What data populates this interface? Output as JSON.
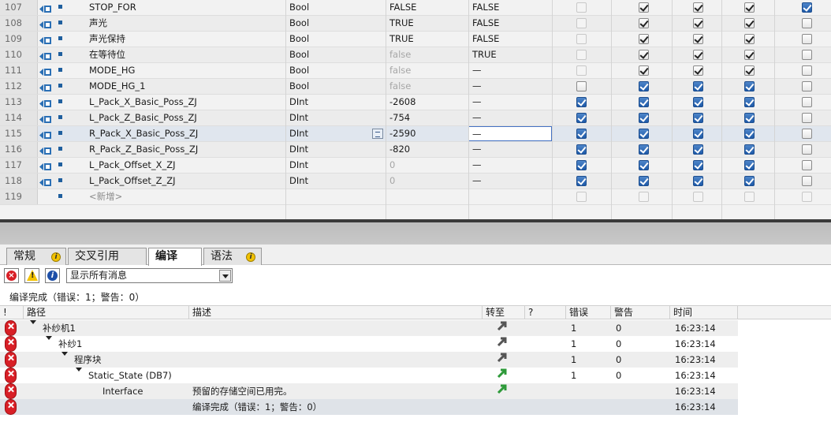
{
  "db_table": {
    "rows": [
      {
        "num": "107",
        "name": "STOP_FOR",
        "type": "Bool",
        "start": "FALSE",
        "start_dim": false,
        "monitor": "FALSE",
        "cb": [
          "dis",
          "on",
          "on",
          "on",
          "blue"
        ]
      },
      {
        "num": "108",
        "name": "声光",
        "type": "Bool",
        "start": "TRUE",
        "start_dim": false,
        "monitor": "FALSE",
        "cb": [
          "dis",
          "on",
          "on",
          "on",
          "off"
        ]
      },
      {
        "num": "109",
        "name": "声光保持",
        "type": "Bool",
        "start": "TRUE",
        "start_dim": false,
        "monitor": "FALSE",
        "cb": [
          "dis",
          "on",
          "on",
          "on",
          "off"
        ]
      },
      {
        "num": "110",
        "name": "在等待位",
        "type": "Bool",
        "start": "false",
        "start_dim": true,
        "monitor": "TRUE",
        "cb": [
          "dis",
          "on",
          "on",
          "on",
          "off"
        ]
      },
      {
        "num": "111",
        "name": "MODE_HG",
        "type": "Bool",
        "start": "false",
        "start_dim": true,
        "monitor": "—",
        "cb": [
          "dis",
          "on",
          "on",
          "on",
          "off"
        ]
      },
      {
        "num": "112",
        "name": "MODE_HG_1",
        "type": "Bool",
        "start": "false",
        "start_dim": true,
        "monitor": "—",
        "cb": [
          "off",
          "blue",
          "blue",
          "blue",
          "off"
        ]
      },
      {
        "num": "113",
        "name": "L_Pack_X_Basic_Poss_ZJ",
        "type": "DInt",
        "start": "-2608",
        "start_dim": false,
        "monitor": "—",
        "cb": [
          "blue",
          "blue",
          "blue",
          "blue",
          "off"
        ]
      },
      {
        "num": "114",
        "name": "L_Pack_Z_Basic_Poss_ZJ",
        "type": "DInt",
        "start": "-754",
        "start_dim": false,
        "monitor": "—",
        "cb": [
          "blue",
          "blue",
          "blue",
          "blue",
          "off"
        ]
      },
      {
        "num": "115",
        "name": "R_Pack_X_Basic_Poss_ZJ",
        "type": "DInt",
        "start": "-2590",
        "start_dim": false,
        "monitor": "—",
        "cb": [
          "blue",
          "blue",
          "blue",
          "blue",
          "off"
        ]
      },
      {
        "num": "116",
        "name": "R_Pack_Z_Basic_Poss_ZJ",
        "type": "DInt",
        "start": "-820",
        "start_dim": false,
        "monitor": "—",
        "cb": [
          "blue",
          "blue",
          "blue",
          "blue",
          "off"
        ]
      },
      {
        "num": "117",
        "name": "L_Pack_Offset_X_ZJ",
        "type": "DInt",
        "start": "0",
        "start_dim": true,
        "monitor": "—",
        "cb": [
          "blue",
          "blue",
          "blue",
          "blue",
          "off"
        ]
      },
      {
        "num": "118",
        "name": "L_Pack_Offset_Z_ZJ",
        "type": "DInt",
        "start": "0",
        "start_dim": true,
        "monitor": "—",
        "cb": [
          "blue",
          "blue",
          "blue",
          "blue",
          "off"
        ]
      }
    ],
    "add_row": {
      "num": "119",
      "placeholder": "<新增>"
    }
  },
  "tabs": {
    "general": "常规",
    "cross_ref": "交叉引用",
    "compile": "编译",
    "syntax": "语法"
  },
  "filter": {
    "selected": "显示所有消息"
  },
  "summary": "编译完成（错误：1；警告：0）",
  "messages": {
    "headers": {
      "excl": "!",
      "path": "路径",
      "desc": "描述",
      "goto": "转至",
      "q": "?",
      "errors": "错误",
      "warnings": "警告",
      "time": "时间"
    },
    "rows": [
      {
        "path": "补纱机1",
        "desc": "",
        "errors": "1",
        "warnings": "0",
        "time": "16:23:14",
        "goto_color": "#555555"
      },
      {
        "path": "补纱1",
        "desc": "",
        "errors": "1",
        "warnings": "0",
        "time": "16:23:14",
        "goto_color": "#555555"
      },
      {
        "path": "程序块",
        "desc": "",
        "errors": "1",
        "warnings": "0",
        "time": "16:23:14",
        "goto_color": "#555555"
      },
      {
        "path": "Static_State (DB7)",
        "desc": "",
        "errors": "1",
        "warnings": "0",
        "time": "16:23:14",
        "goto_color": "#2e9a3a"
      },
      {
        "path": "Interface",
        "desc": "预留的存储空间已用完。",
        "errors": "",
        "warnings": "",
        "time": "16:23:14",
        "goto_color": "#2e9a3a"
      },
      {
        "path": "",
        "desc": "编译完成（错误：1；警告：0）",
        "errors": "",
        "warnings": "",
        "time": "16:23:14",
        "goto_color": ""
      }
    ]
  },
  "colors": {
    "error": "#d81f26",
    "checkbox_blue": "#1e5aa8",
    "info": "#f2c200"
  }
}
